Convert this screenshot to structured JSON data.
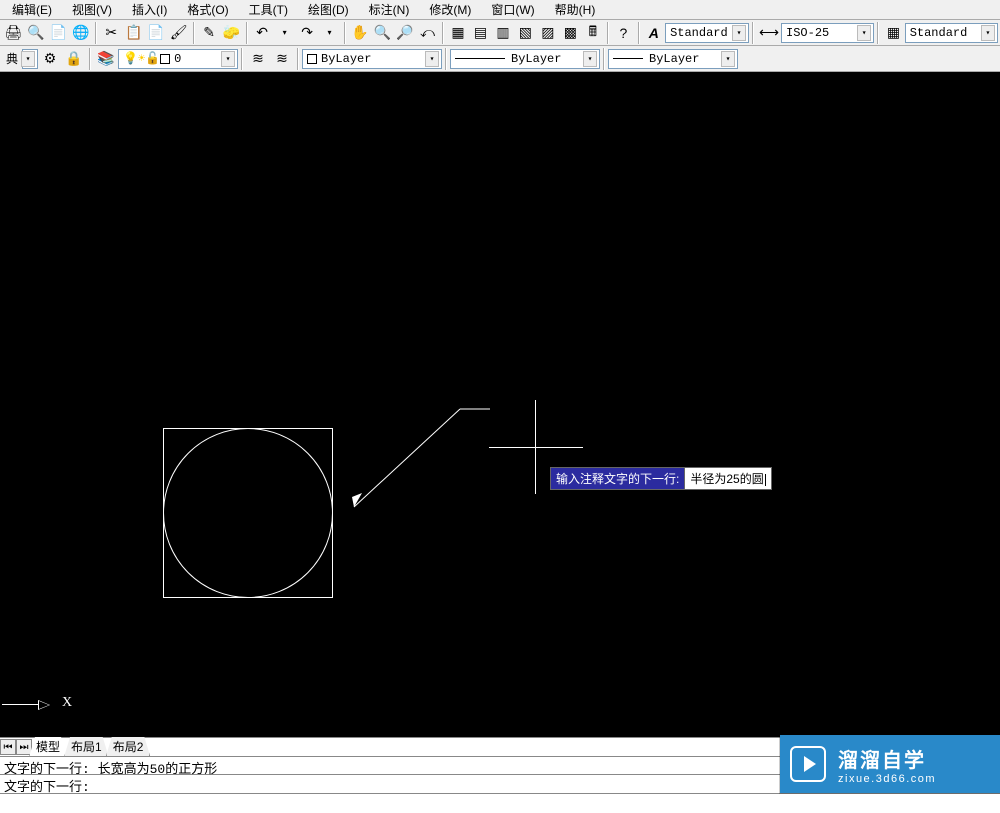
{
  "menu": {
    "items": [
      {
        "label": "编辑(E)"
      },
      {
        "label": "视图(V)"
      },
      {
        "label": "插入(I)"
      },
      {
        "label": "格式(O)"
      },
      {
        "label": "工具(T)"
      },
      {
        "label": "绘图(D)"
      },
      {
        "label": "标注(N)"
      },
      {
        "label": "修改(M)"
      },
      {
        "label": "窗口(W)"
      },
      {
        "label": "帮助(H)"
      }
    ]
  },
  "toolbar1": {
    "icons": [
      "print-icon",
      "preview-icon",
      "publish-icon",
      "globe-icon",
      "cut-icon",
      "copy-icon",
      "paste-icon",
      "match-icon",
      "brush-icon",
      "eraser-icon",
      "undo-icon",
      "redo-icon",
      "pan-icon",
      "zoom-extents-icon",
      "zoom-in-icon",
      "zoom-window-icon",
      "zoom-previous-icon",
      "design-center-icon",
      "tool-palette-icon",
      "sheet-set-icon",
      "markup-icon",
      "layers-icon",
      "qcalc-icon",
      "calc-icon",
      "help-icon"
    ],
    "text_style_dropdown": "Standard",
    "dim_style_dropdown": "ISO-25",
    "table_style_dropdown": "Standard"
  },
  "toolbar2": {
    "classical": "典",
    "layer_dropdown": "0",
    "bylayer_dropdown": "ByLayer",
    "linetype_dropdown": "ByLayer",
    "lineweight_dropdown": "ByLayer"
  },
  "dynamic_input": {
    "prompt_label": "输入注释文字的下一行:",
    "input_value": "半径为25的圆"
  },
  "tabs": {
    "model": "模型",
    "layout1": "布局1",
    "layout2": "布局2"
  },
  "commandline": {
    "line1": "文字的下一行: 长宽高为50的正方形",
    "line2": "文字的下一行:"
  },
  "ucs": {
    "x_label": "X"
  },
  "watermark": {
    "title": "溜溜自学",
    "url": "zixue.3d66.com"
  }
}
